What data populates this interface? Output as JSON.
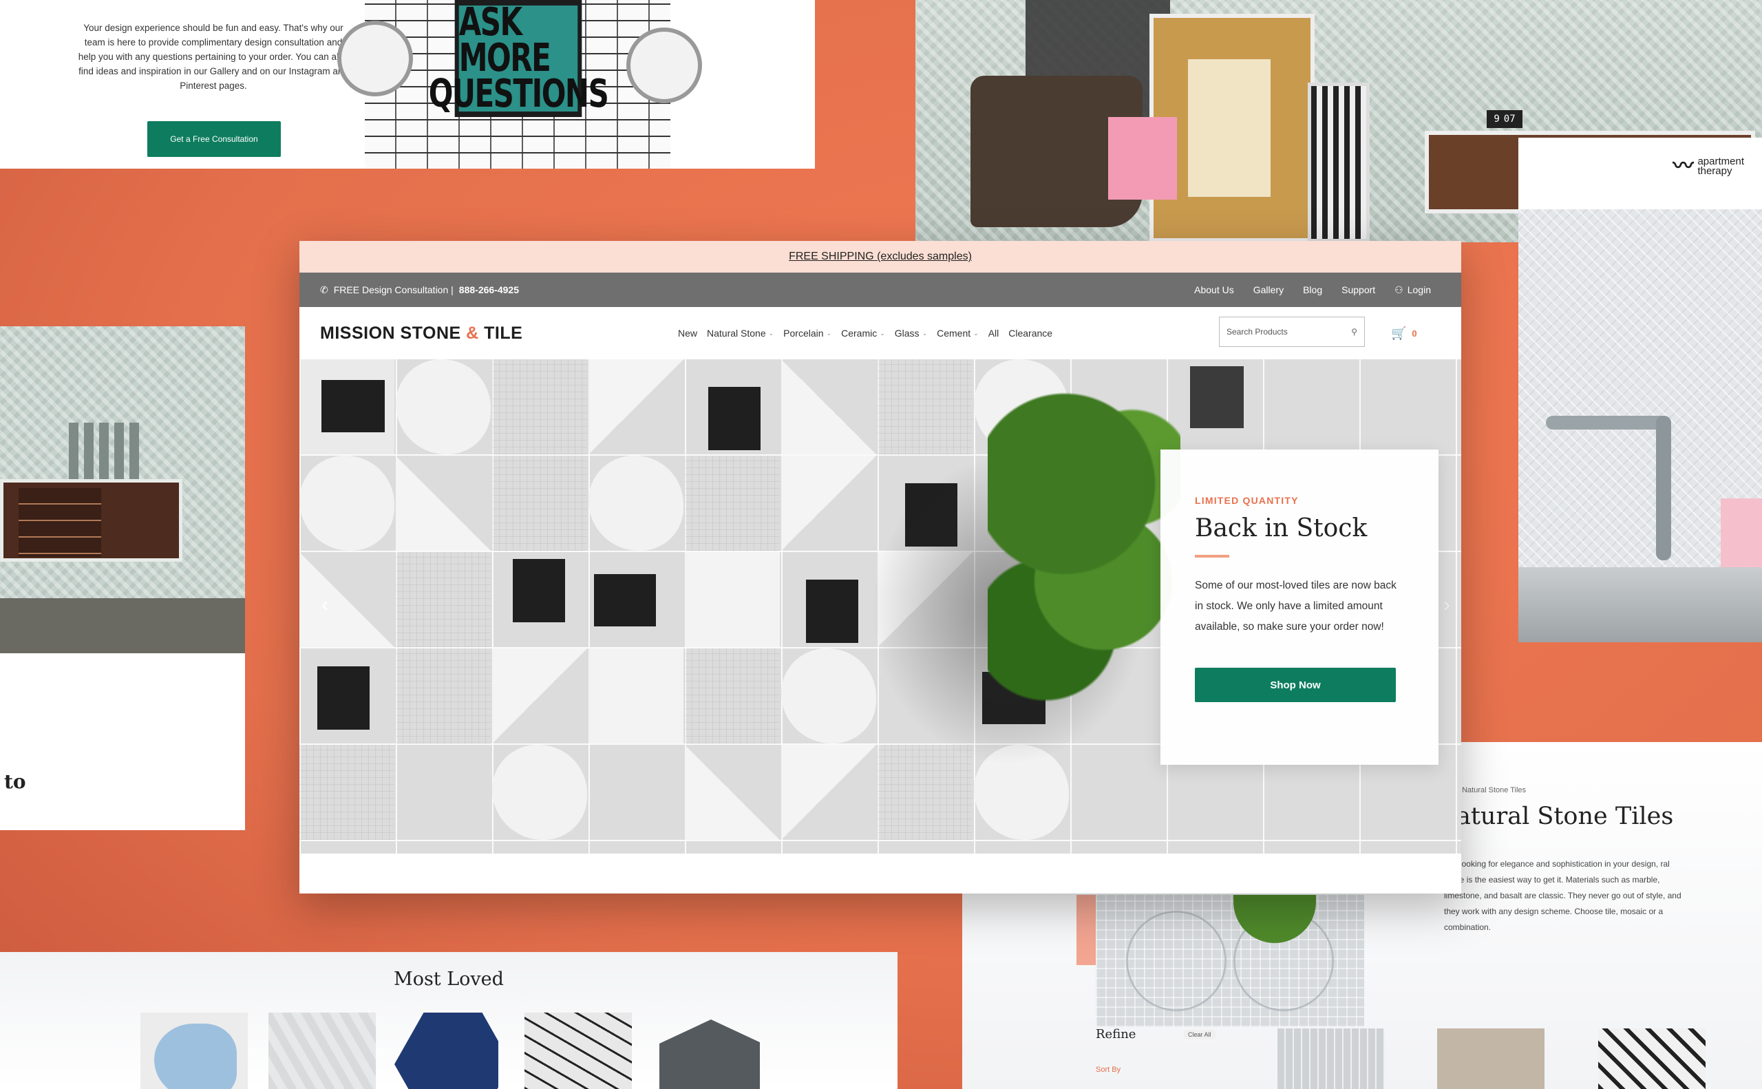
{
  "colors": {
    "background": "#e8714e",
    "accent": "#e8714e",
    "button_green": "#0e7d5f",
    "shipping_bar": "#fbdfd4",
    "utility_bar": "#6f6f6f"
  },
  "consultation": {
    "text": "Your design experience should be fun and easy. That's why our team is here to provide complimentary design consultation and help you with any questions pertaining to your order. You can also find ideas and inspiration in our Gallery and on our Instagram and Pinterest pages.",
    "button": "Get a Free Consultation",
    "poster_line1": "ASK MORE",
    "poster_line2": "QUESTIONS"
  },
  "room_photo": {
    "clock_digits": [
      "9",
      "07"
    ]
  },
  "left_panel": {
    "fragment": "to"
  },
  "right_panel": {
    "logo_mark": "〰",
    "logo_line1": "apartment",
    "logo_line2": "therapy"
  },
  "main": {
    "shipping": "FREE SHIPPING (excludes samples)",
    "utility": {
      "phone_icon": "phone-icon",
      "consult_label": "FREE Design Consultation |",
      "phone": "888-266-4925",
      "links": [
        "About Us",
        "Gallery",
        "Blog",
        "Support"
      ],
      "login": "Login"
    },
    "brand": {
      "part1": "MISSION STONE",
      "amp": "&",
      "part2": "TILE"
    },
    "menu": [
      {
        "label": "New",
        "dropdown": false
      },
      {
        "label": "Natural Stone",
        "dropdown": true
      },
      {
        "label": "Porcelain",
        "dropdown": true
      },
      {
        "label": "Ceramic",
        "dropdown": true
      },
      {
        "label": "Glass",
        "dropdown": true
      },
      {
        "label": "Cement",
        "dropdown": true
      },
      {
        "label": "All",
        "dropdown": false
      },
      {
        "label": "Clearance",
        "dropdown": false
      }
    ],
    "search": {
      "placeholder": "Search Products",
      "icon": "search-icon"
    },
    "cart": {
      "icon": "cart-icon",
      "count": "0"
    },
    "hero": {
      "prev_arrow": "‹",
      "next_arrow": "›",
      "card": {
        "eyebrow": "LIMITED QUANTITY",
        "title": "Back in Stock",
        "body": "Some of our most-loved tiles are now back in stock. We only have a limited amount available, so make sure your order now!",
        "cta": "Shop Now"
      }
    }
  },
  "most_loved": {
    "title": "Most Loved"
  },
  "category": {
    "breadcrumb": "/ Natural Stone Tiles",
    "heading": "atural Stone Tiles",
    "description": "u're looking for elegance and sophistication in your design, ral stone is the easiest way to get it. Materials such as marble, limestone, and basalt are classic. They never go out of style, and they work with any design scheme. Choose tile, mosaic or a combination.",
    "refine": "Refine",
    "clear_all": "Clear All",
    "sort_by": "Sort By"
  }
}
